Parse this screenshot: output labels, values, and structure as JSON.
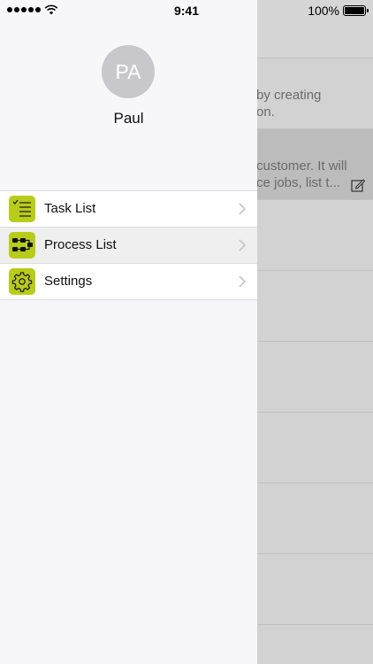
{
  "status_bar": {
    "time": "9:41",
    "battery": "100%"
  },
  "profile": {
    "initials": "PA",
    "name": "Paul"
  },
  "menu": [
    {
      "label": "Task List",
      "icon": "checklist-icon",
      "active": false
    },
    {
      "label": "Process List",
      "icon": "process-flow-icon",
      "active": true
    },
    {
      "label": "Settings",
      "icon": "gear-icon",
      "active": false
    }
  ],
  "background": {
    "row1_line1": "by creating",
    "row1_line2": "on.",
    "row2_line1": "customer. It will",
    "row2_line2": "ce jobs, list t..."
  },
  "colors": {
    "accent": "#b8cc18",
    "avatar_bg": "#c7c7cc"
  }
}
